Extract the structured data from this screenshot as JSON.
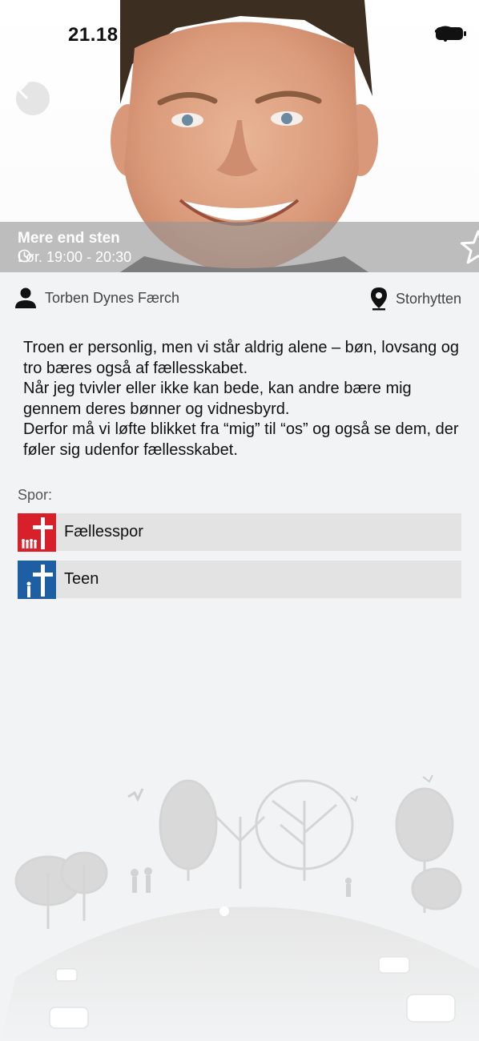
{
  "status_bar": {
    "time": "21.18"
  },
  "event": {
    "title": "Mere end sten",
    "time": "Lør. 19:00 - 20:30",
    "speaker": "Torben Dynes Færch",
    "location": "Storhytten",
    "description": [
      "Troen er personlig, men vi står aldrig alene – bøn, lovsang og tro bæres også af fællesskabet.",
      "Når jeg tvivler eller ikke kan bede, kan andre bære mig gennem deres bønner og vidnesbyrd.",
      "Derfor må vi løfte blikket fra “mig” til “os” og også se dem, der føler sig udenfor fællesskabet."
    ]
  },
  "tracks_section": {
    "label": "Spor:",
    "items": [
      {
        "label": "Fællesspor",
        "color": "#d8202a",
        "icon": "cross-group-icon"
      },
      {
        "label": "Teen",
        "color": "#1e5fa3",
        "icon": "cross-person-icon"
      }
    ]
  },
  "icons": {
    "back": "chevron-left-icon",
    "favorite": "star-outline-icon",
    "clock": "clock-icon",
    "speaker": "person-icon",
    "location": "location-pin-icon"
  }
}
